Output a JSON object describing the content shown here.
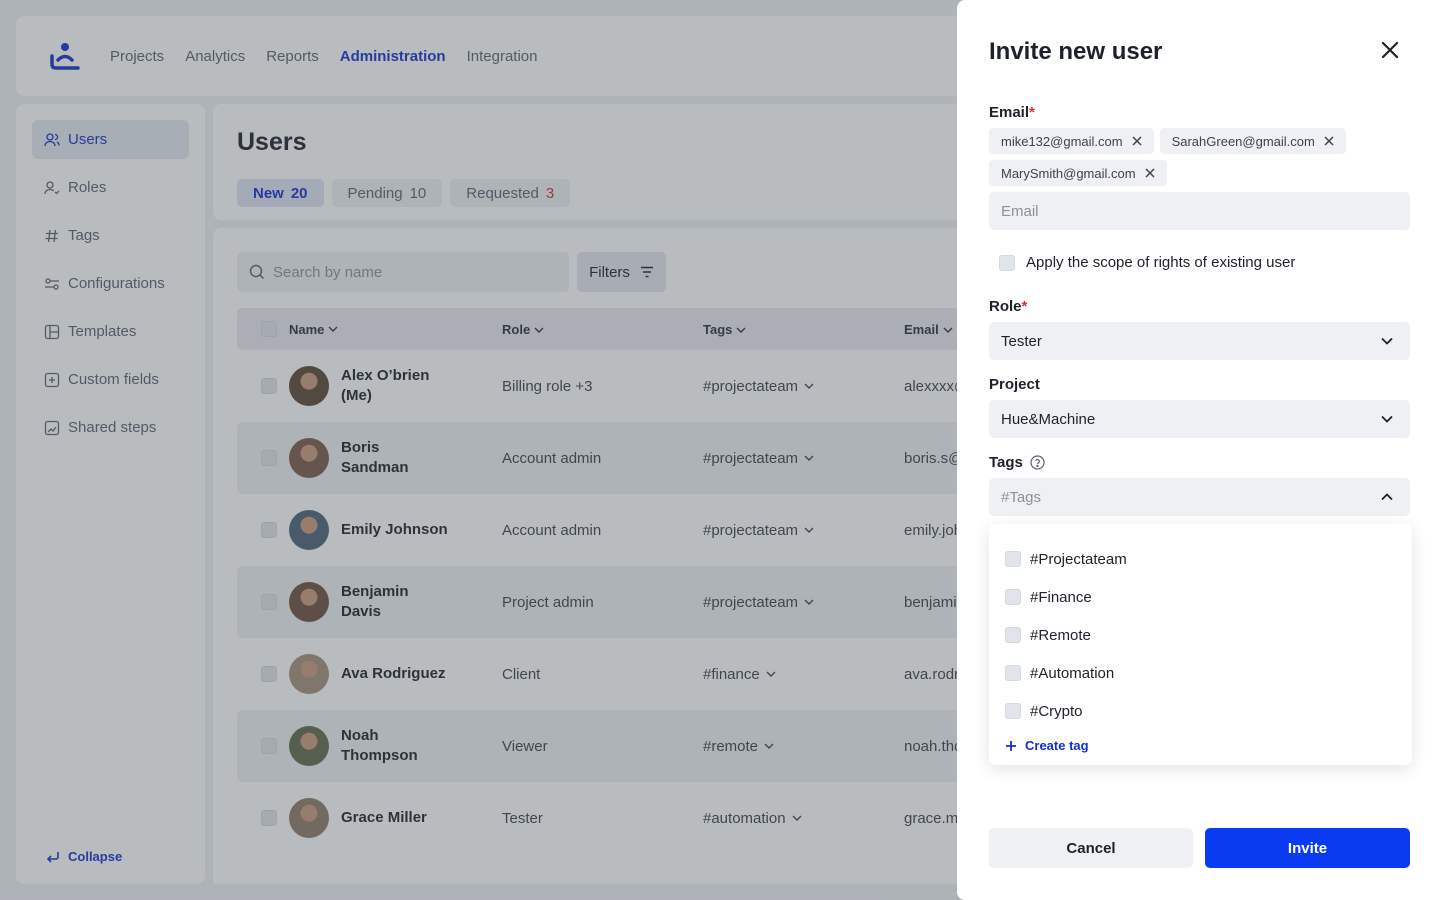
{
  "nav": {
    "items": [
      "Projects",
      "Analytics",
      "Reports",
      "Administration",
      "Integration"
    ],
    "active": "Administration"
  },
  "sidebar": {
    "items": [
      {
        "label": "Users",
        "icon": "users-icon"
      },
      {
        "label": "Roles",
        "icon": "roles-icon"
      },
      {
        "label": "Tags",
        "icon": "hash-icon"
      },
      {
        "label": "Configurations",
        "icon": "sliders-icon"
      },
      {
        "label": "Templates",
        "icon": "template-icon"
      },
      {
        "label": "Custom fields",
        "icon": "plus-square-icon"
      },
      {
        "label": "Shared steps",
        "icon": "steps-icon"
      }
    ],
    "collapse_label": "Collapse"
  },
  "users": {
    "title": "Users",
    "tabs": [
      {
        "label": "New",
        "count": "20"
      },
      {
        "label": "Pending",
        "count": "10"
      },
      {
        "label": "Requested",
        "count": "3"
      }
    ],
    "search_placeholder": "Search by name",
    "filters_label": "Filters",
    "columns": [
      "Name",
      "Role",
      "Tags",
      "Email"
    ],
    "rows": [
      {
        "name": "Alex O’brien (Me)",
        "role": "Billing role +3",
        "tag": "#projectateam",
        "email": "alexxxx@"
      },
      {
        "name": "Boris Sandman",
        "role": "Account admin",
        "tag": "#projectateam",
        "email": "boris.s@"
      },
      {
        "name": "Emily Johnson",
        "role": "Account admin",
        "tag": "#projectateam",
        "email": "emily.joh"
      },
      {
        "name": "Benjamin Davis",
        "role": "Project admin",
        "tag": "#projectateam",
        "email": "benjami"
      },
      {
        "name": "Ava Rodriguez",
        "role": "Client",
        "tag": "#finance",
        "email": "ava.rodr"
      },
      {
        "name": "Noah Thompson",
        "role": "Viewer",
        "tag": "#remote",
        "email": "noah.tho"
      },
      {
        "name": "Grace Miller",
        "role": "Tester",
        "tag": "#automation",
        "email": "grace.m"
      }
    ]
  },
  "invite": {
    "title": "Invite new user",
    "email_label": "Email",
    "required_mark": "*",
    "emails": [
      "mike132@gmail.com",
      "SarahGreen@gmail.com",
      "MarySmith@gmail.com"
    ],
    "email_placeholder": "Email",
    "apply_scope_label": "Apply the scope of rights of existing user",
    "role_label": "Role",
    "role_value": "Tester",
    "project_label": "Project",
    "project_value": "Hue&Machine",
    "tags_label": "Tags",
    "tags_placeholder": "#Tags",
    "tag_options": [
      "#Projectateam",
      "#Finance",
      "#Remote",
      "#Automation",
      "#Crypto"
    ],
    "create_tag_label": "Create tag",
    "cancel_label": "Cancel",
    "invite_label": "Invite"
  },
  "colors": {
    "accent": "#1230c8",
    "primary_button": "#0b3bf0",
    "required": "#d92d2d"
  }
}
